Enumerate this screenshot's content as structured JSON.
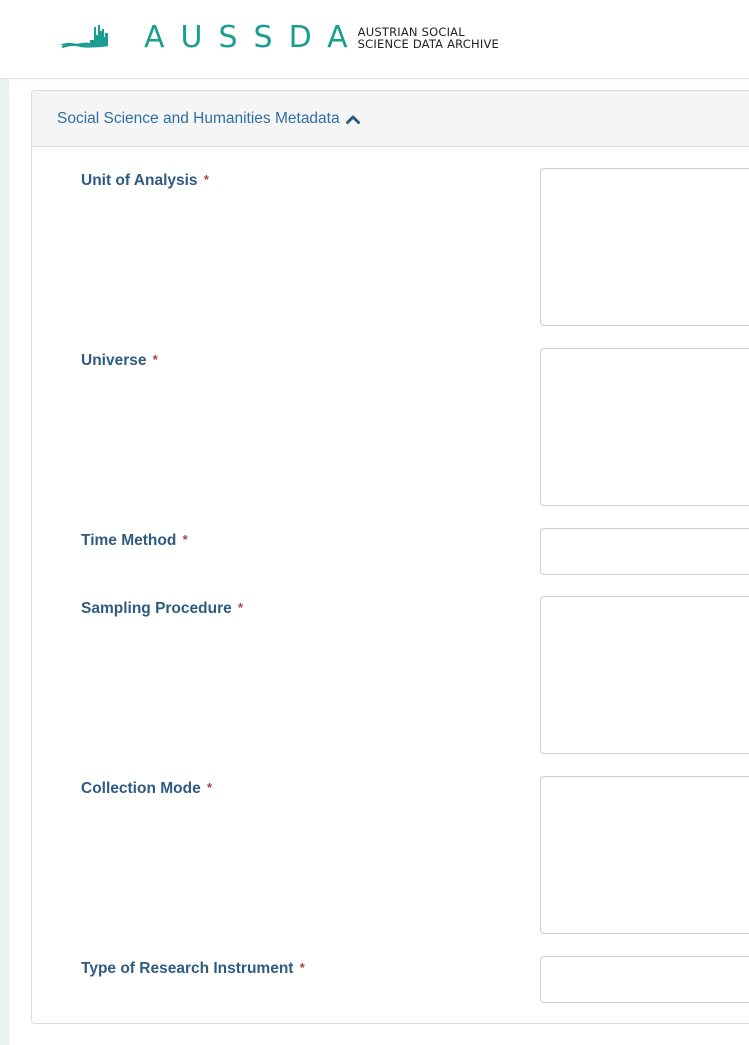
{
  "header": {
    "logo_word": "AUSSDA",
    "logo_sub_line1": "AUSTRIAN SOCIAL",
    "logo_sub_line2": "SCIENCE DATA ARCHIVE",
    "logo_mark_icon": "graph-mark-icon"
  },
  "panel": {
    "title": "Social Science and Humanities Metadata",
    "toggle_icon": "chevron-up-icon"
  },
  "fields": [
    {
      "label": "Unit of Analysis",
      "required": "*"
    },
    {
      "label": "Universe",
      "required": "*"
    },
    {
      "label": "Time Method",
      "required": "*"
    },
    {
      "label": "Sampling Procedure",
      "required": "*"
    },
    {
      "label": "Collection Mode",
      "required": "*"
    },
    {
      "label": "Type of Research Instrument",
      "required": "*"
    }
  ],
  "colors": {
    "brand": "#1a9e8f",
    "label": "#2f5a82",
    "required": "#a94442",
    "panel_title": "#2f6fa3"
  }
}
